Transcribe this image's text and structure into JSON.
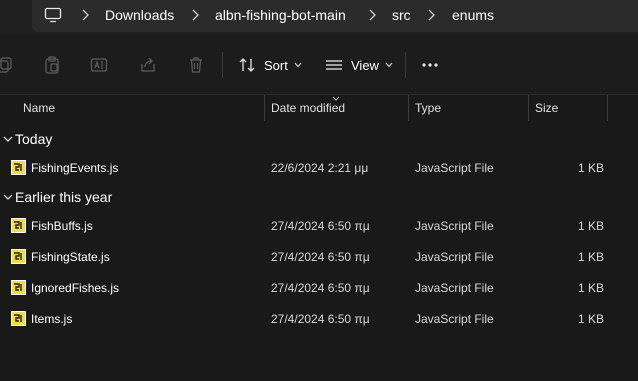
{
  "breadcrumb": {
    "items": [
      "Downloads",
      "albn-fishing-bot-main",
      "src",
      "enums"
    ]
  },
  "toolbar": {
    "sort_label": "Sort",
    "view_label": "View"
  },
  "columns": {
    "name": "Name",
    "date_modified": "Date modified",
    "type": "Type",
    "size": "Size"
  },
  "groups": [
    {
      "label": "Today",
      "files": [
        {
          "name": "FishingEvents.js",
          "date": "22/6/2024 2:21 μμ",
          "type": "JavaScript File",
          "size": "1 KB"
        }
      ]
    },
    {
      "label": "Earlier this year",
      "files": [
        {
          "name": "FishBuffs.js",
          "date": "27/4/2024 6:50 πμ",
          "type": "JavaScript File",
          "size": "1 KB"
        },
        {
          "name": "FishingState.js",
          "date": "27/4/2024 6:50 πμ",
          "type": "JavaScript File",
          "size": "1 KB"
        },
        {
          "name": "IgnoredFishes.js",
          "date": "27/4/2024 6:50 πμ",
          "type": "JavaScript File",
          "size": "1 KB"
        },
        {
          "name": "Items.js",
          "date": "27/4/2024 6:50 πμ",
          "type": "JavaScript File",
          "size": "1 KB"
        }
      ]
    }
  ],
  "colors": {
    "background": "#191919",
    "toolbar": "#1c1c1c",
    "address_box": "#2b2b2b",
    "text": "#ffffff",
    "js_icon": "#f0db4f"
  }
}
